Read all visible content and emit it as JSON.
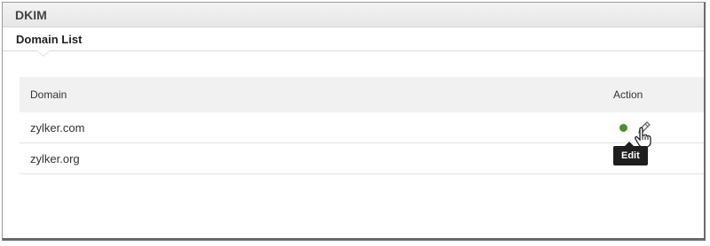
{
  "header": {
    "title": "DKIM"
  },
  "subheader": {
    "tab_label": "Domain List"
  },
  "table": {
    "columns": [
      "Domain",
      "Action"
    ],
    "rows": [
      {
        "domain": "zylker.com",
        "status": "active",
        "status_color": "#4c8f2b"
      },
      {
        "domain": "zylker.org"
      }
    ]
  },
  "tooltip": {
    "text": "Edit"
  },
  "icons": {
    "edit": "pencil-icon",
    "cursor": "hand-cursor-icon"
  }
}
